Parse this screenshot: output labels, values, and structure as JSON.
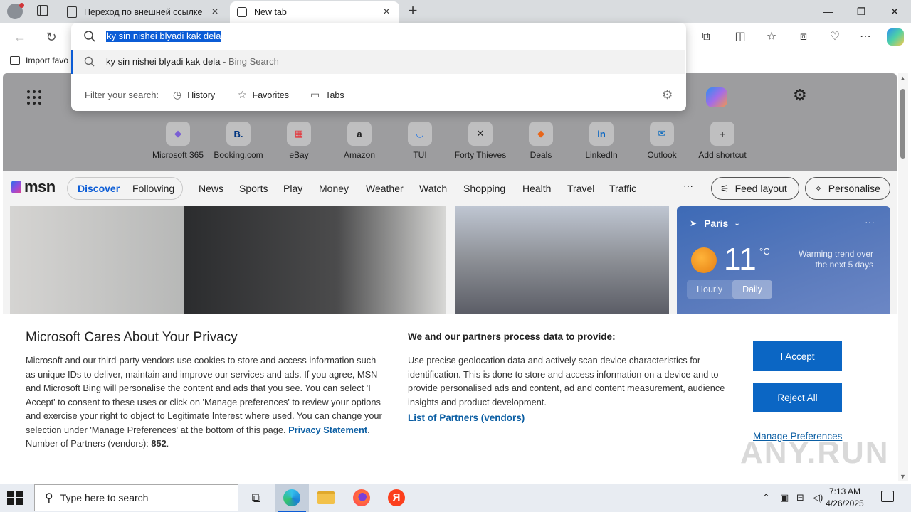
{
  "browser": {
    "tabs": [
      {
        "label": "Переход по внешней ссылке",
        "active": false
      },
      {
        "label": "New tab",
        "active": true
      }
    ],
    "window_controls": {
      "minimize": "—",
      "maximize": "❐",
      "close": "✕"
    }
  },
  "omnibox": {
    "query": "ky sin nishei blyadi kak dela",
    "suggestion": {
      "text": "ky sin nishei blyadi kak dela",
      "source": " - Bing Search"
    },
    "filter_label": "Filter your search:",
    "filters": [
      "History",
      "Favorites",
      "Tabs"
    ]
  },
  "bookmarks": {
    "import_label": "Import favo"
  },
  "ntp": {
    "shortcuts": [
      {
        "label": "Microsoft 365",
        "glyph": "◆",
        "color": "#7a5fd3"
      },
      {
        "label": "Booking.com",
        "glyph": "B.",
        "color": "#003580"
      },
      {
        "label": "eBay",
        "glyph": "▦",
        "color": "#e53238"
      },
      {
        "label": "Amazon",
        "glyph": "a",
        "color": "#222222"
      },
      {
        "label": "TUI",
        "glyph": "◡",
        "color": "#1a73e8"
      },
      {
        "label": "Forty Thieves",
        "glyph": "✕",
        "color": "#222222"
      },
      {
        "label": "Deals",
        "glyph": "◆",
        "color": "#e8661a"
      },
      {
        "label": "LinkedIn",
        "glyph": "in",
        "color": "#0a66c2"
      },
      {
        "label": "Outlook",
        "glyph": "✉",
        "color": "#0f6cbd"
      },
      {
        "label": "Add shortcut",
        "glyph": "+",
        "color": "#333333"
      }
    ]
  },
  "msn": {
    "logo": "msn",
    "primary_tabs": [
      "Discover",
      "Following"
    ],
    "nav": [
      "News",
      "Sports",
      "Play",
      "Money",
      "Weather",
      "Watch",
      "Shopping",
      "Health",
      "Travel",
      "Traffic"
    ],
    "more": "···",
    "feed_layout": "Feed layout",
    "personalise": "Personalise"
  },
  "weather": {
    "city": "Paris",
    "temp": "11",
    "unit": "°C",
    "trend": "Warming trend over the next 5 days",
    "tabs": [
      "Hourly",
      "Daily"
    ],
    "selected_tab": "Daily"
  },
  "privacy": {
    "title": "Microsoft Cares About Your Privacy",
    "body": "Microsoft and our third-party vendors use cookies to store and access information such as unique IDs to deliver, maintain and improve our services and ads. If you agree, MSN and Microsoft Bing will personalise the content and ads that you see. You can select 'I Accept' to consent to these uses or click on 'Manage preferences' to review your options and exercise your right to object to Legitimate Interest where used.  You can change your selection under 'Manage Preferences' at the bottom of this page. ",
    "privacy_link": "Privacy Statement",
    "partners_label": "Number of Partners (vendors): ",
    "partners_count": "852",
    "heading2": "We and our partners process data to provide:",
    "body2": "Use precise geolocation data and actively scan device characteristics for identification. This is done to store and access information on a device and to provide personalised ads and content, ad and content measurement, audience insights and product development.",
    "partners_link": "List of Partners (vendors)",
    "accept": "I Accept",
    "reject": "Reject All",
    "manage": "Manage Preferences",
    "watermark": "ANY.RUN"
  },
  "taskbar": {
    "search_placeholder": "Type here to search",
    "time": "7:13 AM",
    "date": "4/26/2025"
  }
}
